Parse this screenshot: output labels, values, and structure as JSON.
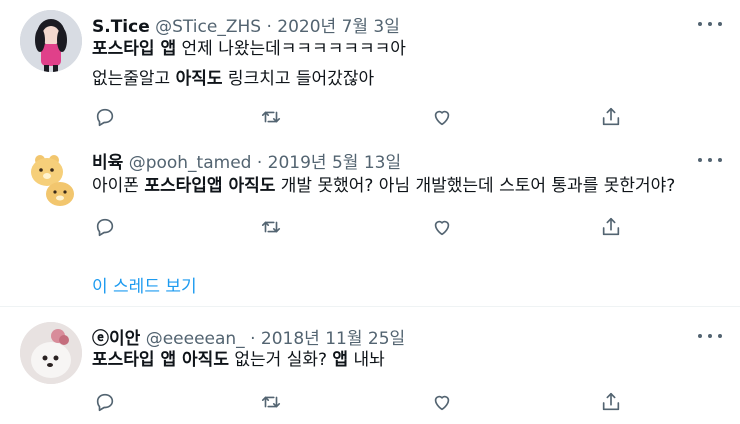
{
  "tweets": [
    {
      "name": "S.Tice",
      "handle": "@STice_ZHS",
      "dot": "·",
      "date": "2020년 7월 3일",
      "lines": [
        {
          "b1": "포스타입 앱",
          "t1": " 언제 나왔는데ㅋㅋㅋㅋㅋㅋㅋ아"
        },
        {
          "t0": "없는줄알고 ",
          "b1": "아직도",
          "t1": " 링크치고 들어갔잖아"
        }
      ]
    },
    {
      "name": "비육",
      "handle": "@pooh_tamed",
      "dot": "·",
      "date": "2019년 5월 13일",
      "lines": [
        {
          "t0": "아이폰 ",
          "b1": "포스타입앱 아직도",
          "t1": " 개발 못했어? 아님 개발했는데 스토어 통과를 못한거야?"
        }
      ]
    },
    {
      "name": "ⓔ이안",
      "handle": "@eeeeean_",
      "dot": "·",
      "date": "2018년 11월 25일",
      "lines": [
        {
          "b1": "포스타입 앱 아직도",
          "t1": " 없는거 실화? ",
          "b2": "앱",
          "t2": " 내놔"
        }
      ]
    }
  ],
  "thread_link": "이 스레드 보기",
  "icons": [
    "reply-icon",
    "retweet-icon",
    "like-icon",
    "share-icon",
    "more-icon"
  ],
  "colors": {
    "text": "#0f1419",
    "secondary": "#536471",
    "accent": "#1d9bf0"
  }
}
